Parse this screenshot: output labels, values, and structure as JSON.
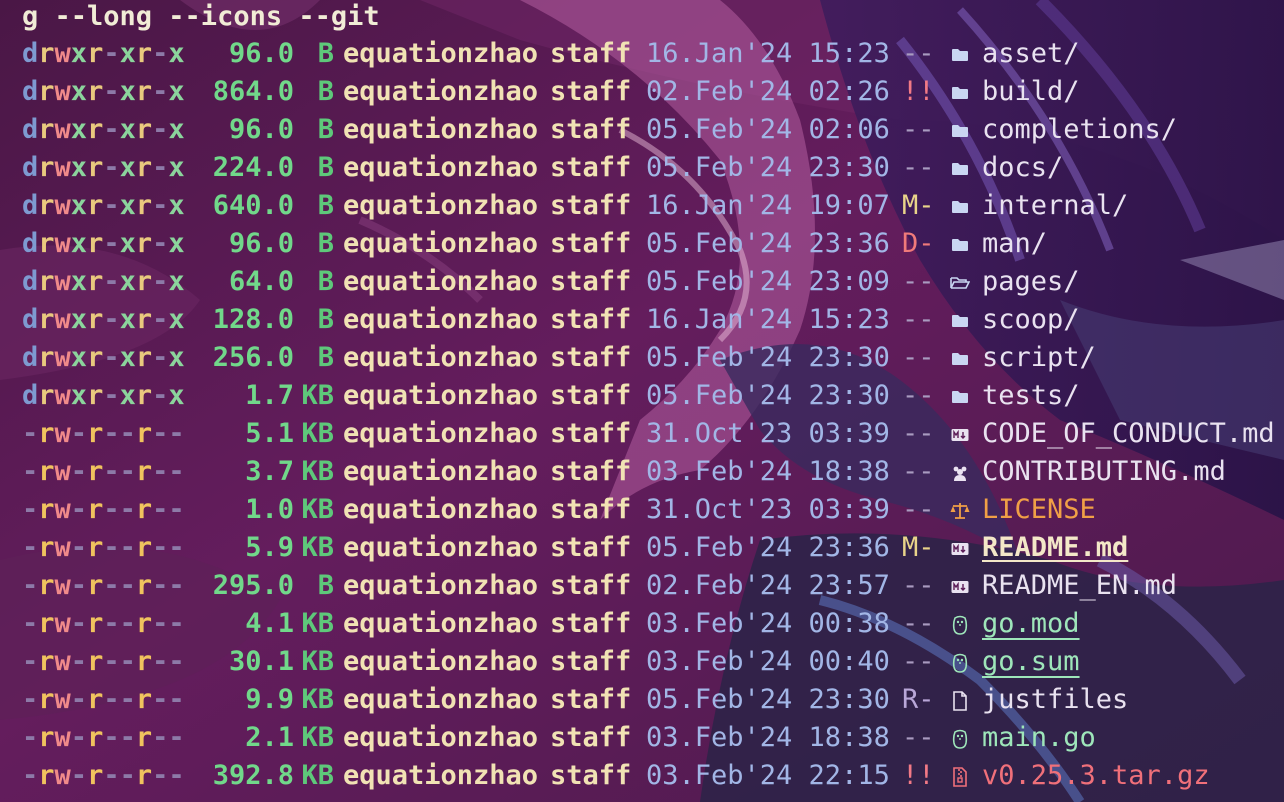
{
  "command": "g --long --icons --git",
  "colors": {
    "background": "#5a1b56",
    "size": "#71d88a",
    "owner": "#f1e2b4",
    "date": "#a2b6e6",
    "name": "#e9e2f0",
    "license": "#f0a046",
    "go_file": "#9ee6ba",
    "archive": "#f0707a"
  },
  "rows": [
    {
      "perms": "drwxr-xr-x",
      "size": "96.0",
      "unit": "B",
      "user": "equationzhao",
      "group": "staff",
      "date": "16.Jan'24 15:23",
      "git": "--",
      "icon": "folder-icon",
      "name": "asset/",
      "kind": "dir"
    },
    {
      "perms": "drwxr-xr-x",
      "size": "864.0",
      "unit": "B",
      "user": "equationzhao",
      "group": "staff",
      "date": "02.Feb'24 02:26",
      "git": "!!",
      "icon": "folder-icon",
      "name": "build/",
      "kind": "dir"
    },
    {
      "perms": "drwxr-xr-x",
      "size": "96.0",
      "unit": "B",
      "user": "equationzhao",
      "group": "staff",
      "date": "05.Feb'24 02:06",
      "git": "--",
      "icon": "folder-icon",
      "name": "completions/",
      "kind": "dir"
    },
    {
      "perms": "drwxr-xr-x",
      "size": "224.0",
      "unit": "B",
      "user": "equationzhao",
      "group": "staff",
      "date": "05.Feb'24 23:30",
      "git": "--",
      "icon": "folder-icon",
      "name": "docs/",
      "kind": "dir"
    },
    {
      "perms": "drwxr-xr-x",
      "size": "640.0",
      "unit": "B",
      "user": "equationzhao",
      "group": "staff",
      "date": "16.Jan'24 19:07",
      "git": "M-",
      "icon": "folder-icon",
      "name": "internal/",
      "kind": "dir"
    },
    {
      "perms": "drwxr-xr-x",
      "size": "96.0",
      "unit": "B",
      "user": "equationzhao",
      "group": "staff",
      "date": "05.Feb'24 23:36",
      "git": "D-",
      "icon": "folder-icon",
      "name": "man/",
      "kind": "dir"
    },
    {
      "perms": "drwxr-xr-x",
      "size": "64.0",
      "unit": "B",
      "user": "equationzhao",
      "group": "staff",
      "date": "05.Feb'24 23:09",
      "git": "--",
      "icon": "folder-open-icon",
      "name": "pages/",
      "kind": "dir"
    },
    {
      "perms": "drwxr-xr-x",
      "size": "128.0",
      "unit": "B",
      "user": "equationzhao",
      "group": "staff",
      "date": "16.Jan'24 15:23",
      "git": "--",
      "icon": "folder-icon",
      "name": "scoop/",
      "kind": "dir"
    },
    {
      "perms": "drwxr-xr-x",
      "size": "256.0",
      "unit": "B",
      "user": "equationzhao",
      "group": "staff",
      "date": "05.Feb'24 23:30",
      "git": "--",
      "icon": "folder-icon",
      "name": "script/",
      "kind": "dir"
    },
    {
      "perms": "drwxr-xr-x",
      "size": "1.7",
      "unit": "KB",
      "user": "equationzhao",
      "group": "staff",
      "date": "05.Feb'24 23:30",
      "git": "--",
      "icon": "folder-icon",
      "name": "tests/",
      "kind": "dir"
    },
    {
      "perms": "-rw-r--r--",
      "size": "5.1",
      "unit": "KB",
      "user": "equationzhao",
      "group": "staff",
      "date": "31.Oct'23 03:39",
      "git": "--",
      "icon": "markdown-icon",
      "name": "CODE_OF_CONDUCT.md",
      "kind": "md"
    },
    {
      "perms": "-rw-r--r--",
      "size": "3.7",
      "unit": "KB",
      "user": "equationzhao",
      "group": "staff",
      "date": "03.Feb'24 18:38",
      "git": "--",
      "icon": "people-icon",
      "name": "CONTRIBUTING.md",
      "kind": "md"
    },
    {
      "perms": "-rw-r--r--",
      "size": "1.0",
      "unit": "KB",
      "user": "equationzhao",
      "group": "staff",
      "date": "31.Oct'23 03:39",
      "git": "--",
      "icon": "scale-icon",
      "name": "LICENSE",
      "kind": "license"
    },
    {
      "perms": "-rw-r--r--",
      "size": "5.9",
      "unit": "KB",
      "user": "equationzhao",
      "group": "staff",
      "date": "05.Feb'24 23:36",
      "git": "M-",
      "icon": "markdown-icon",
      "name": "README.md",
      "kind": "readme"
    },
    {
      "perms": "-rw-r--r--",
      "size": "295.0",
      "unit": "B",
      "user": "equationzhao",
      "group": "staff",
      "date": "02.Feb'24 23:57",
      "git": "--",
      "icon": "markdown-icon",
      "name": "README_EN.md",
      "kind": "md"
    },
    {
      "perms": "-rw-r--r--",
      "size": "4.1",
      "unit": "KB",
      "user": "equationzhao",
      "group": "staff",
      "date": "03.Feb'24 00:38",
      "git": "--",
      "icon": "gopher-icon",
      "name": "go.mod",
      "kind": "gomod"
    },
    {
      "perms": "-rw-r--r--",
      "size": "30.1",
      "unit": "KB",
      "user": "equationzhao",
      "group": "staff",
      "date": "03.Feb'24 00:40",
      "git": "--",
      "icon": "gopher-icon",
      "name": "go.sum",
      "kind": "gomod"
    },
    {
      "perms": "-rw-r--r--",
      "size": "9.9",
      "unit": "KB",
      "user": "equationzhao",
      "group": "staff",
      "date": "05.Feb'24 23:30",
      "git": "R-",
      "icon": "file-icon",
      "name": "justfiles",
      "kind": "file"
    },
    {
      "perms": "-rw-r--r--",
      "size": "2.1",
      "unit": "KB",
      "user": "equationzhao",
      "group": "staff",
      "date": "03.Feb'24 18:38",
      "git": "--",
      "icon": "gopher-icon",
      "name": "main.go",
      "kind": "gomain"
    },
    {
      "perms": "-rw-r--r--",
      "size": "392.8",
      "unit": "KB",
      "user": "equationzhao",
      "group": "staff",
      "date": "03.Feb'24 22:15",
      "git": "!!",
      "icon": "archive-icon",
      "name": "v0.25.3.tar.gz",
      "kind": "archive"
    }
  ]
}
